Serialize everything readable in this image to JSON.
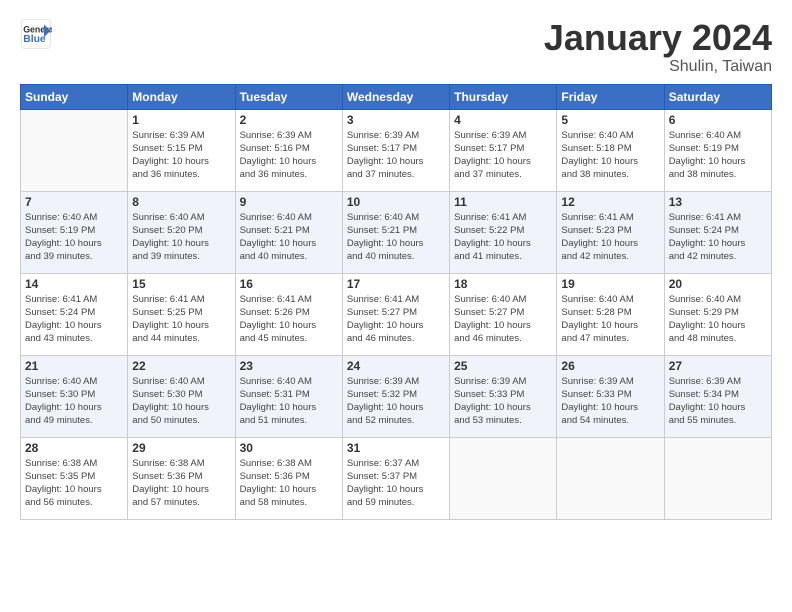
{
  "header": {
    "logo_line1": "General",
    "logo_line2": "Blue",
    "title": "January 2024",
    "subtitle": "Shulin, Taiwan"
  },
  "weekdays": [
    "Sunday",
    "Monday",
    "Tuesday",
    "Wednesday",
    "Thursday",
    "Friday",
    "Saturday"
  ],
  "weeks": [
    [
      {
        "num": "",
        "info": ""
      },
      {
        "num": "1",
        "info": "Sunrise: 6:39 AM\nSunset: 5:15 PM\nDaylight: 10 hours\nand 36 minutes."
      },
      {
        "num": "2",
        "info": "Sunrise: 6:39 AM\nSunset: 5:16 PM\nDaylight: 10 hours\nand 36 minutes."
      },
      {
        "num": "3",
        "info": "Sunrise: 6:39 AM\nSunset: 5:17 PM\nDaylight: 10 hours\nand 37 minutes."
      },
      {
        "num": "4",
        "info": "Sunrise: 6:39 AM\nSunset: 5:17 PM\nDaylight: 10 hours\nand 37 minutes."
      },
      {
        "num": "5",
        "info": "Sunrise: 6:40 AM\nSunset: 5:18 PM\nDaylight: 10 hours\nand 38 minutes."
      },
      {
        "num": "6",
        "info": "Sunrise: 6:40 AM\nSunset: 5:19 PM\nDaylight: 10 hours\nand 38 minutes."
      }
    ],
    [
      {
        "num": "7",
        "info": "Sunrise: 6:40 AM\nSunset: 5:19 PM\nDaylight: 10 hours\nand 39 minutes."
      },
      {
        "num": "8",
        "info": "Sunrise: 6:40 AM\nSunset: 5:20 PM\nDaylight: 10 hours\nand 39 minutes."
      },
      {
        "num": "9",
        "info": "Sunrise: 6:40 AM\nSunset: 5:21 PM\nDaylight: 10 hours\nand 40 minutes."
      },
      {
        "num": "10",
        "info": "Sunrise: 6:40 AM\nSunset: 5:21 PM\nDaylight: 10 hours\nand 40 minutes."
      },
      {
        "num": "11",
        "info": "Sunrise: 6:41 AM\nSunset: 5:22 PM\nDaylight: 10 hours\nand 41 minutes."
      },
      {
        "num": "12",
        "info": "Sunrise: 6:41 AM\nSunset: 5:23 PM\nDaylight: 10 hours\nand 42 minutes."
      },
      {
        "num": "13",
        "info": "Sunrise: 6:41 AM\nSunset: 5:24 PM\nDaylight: 10 hours\nand 42 minutes."
      }
    ],
    [
      {
        "num": "14",
        "info": "Sunrise: 6:41 AM\nSunset: 5:24 PM\nDaylight: 10 hours\nand 43 minutes."
      },
      {
        "num": "15",
        "info": "Sunrise: 6:41 AM\nSunset: 5:25 PM\nDaylight: 10 hours\nand 44 minutes."
      },
      {
        "num": "16",
        "info": "Sunrise: 6:41 AM\nSunset: 5:26 PM\nDaylight: 10 hours\nand 45 minutes."
      },
      {
        "num": "17",
        "info": "Sunrise: 6:41 AM\nSunset: 5:27 PM\nDaylight: 10 hours\nand 46 minutes."
      },
      {
        "num": "18",
        "info": "Sunrise: 6:40 AM\nSunset: 5:27 PM\nDaylight: 10 hours\nand 46 minutes."
      },
      {
        "num": "19",
        "info": "Sunrise: 6:40 AM\nSunset: 5:28 PM\nDaylight: 10 hours\nand 47 minutes."
      },
      {
        "num": "20",
        "info": "Sunrise: 6:40 AM\nSunset: 5:29 PM\nDaylight: 10 hours\nand 48 minutes."
      }
    ],
    [
      {
        "num": "21",
        "info": "Sunrise: 6:40 AM\nSunset: 5:30 PM\nDaylight: 10 hours\nand 49 minutes."
      },
      {
        "num": "22",
        "info": "Sunrise: 6:40 AM\nSunset: 5:30 PM\nDaylight: 10 hours\nand 50 minutes."
      },
      {
        "num": "23",
        "info": "Sunrise: 6:40 AM\nSunset: 5:31 PM\nDaylight: 10 hours\nand 51 minutes."
      },
      {
        "num": "24",
        "info": "Sunrise: 6:39 AM\nSunset: 5:32 PM\nDaylight: 10 hours\nand 52 minutes."
      },
      {
        "num": "25",
        "info": "Sunrise: 6:39 AM\nSunset: 5:33 PM\nDaylight: 10 hours\nand 53 minutes."
      },
      {
        "num": "26",
        "info": "Sunrise: 6:39 AM\nSunset: 5:33 PM\nDaylight: 10 hours\nand 54 minutes."
      },
      {
        "num": "27",
        "info": "Sunrise: 6:39 AM\nSunset: 5:34 PM\nDaylight: 10 hours\nand 55 minutes."
      }
    ],
    [
      {
        "num": "28",
        "info": "Sunrise: 6:38 AM\nSunset: 5:35 PM\nDaylight: 10 hours\nand 56 minutes."
      },
      {
        "num": "29",
        "info": "Sunrise: 6:38 AM\nSunset: 5:36 PM\nDaylight: 10 hours\nand 57 minutes."
      },
      {
        "num": "30",
        "info": "Sunrise: 6:38 AM\nSunset: 5:36 PM\nDaylight: 10 hours\nand 58 minutes."
      },
      {
        "num": "31",
        "info": "Sunrise: 6:37 AM\nSunset: 5:37 PM\nDaylight: 10 hours\nand 59 minutes."
      },
      {
        "num": "",
        "info": ""
      },
      {
        "num": "",
        "info": ""
      },
      {
        "num": "",
        "info": ""
      }
    ]
  ]
}
